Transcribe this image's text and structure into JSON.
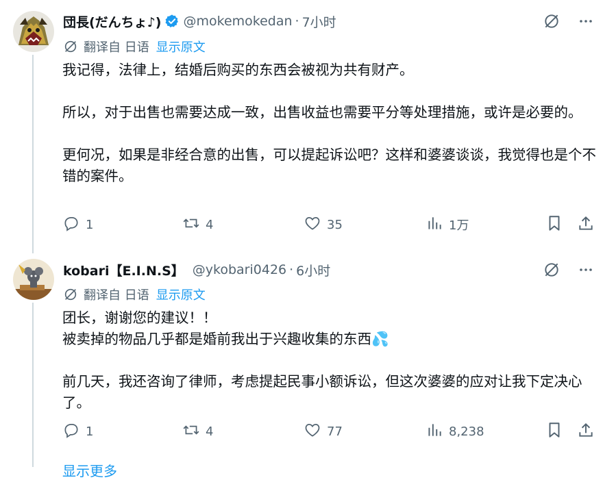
{
  "tweets": [
    {
      "display_name": "団長(だんちょ♪)",
      "verified": true,
      "handle": "@mokemokedan",
      "separator": "·",
      "time": "7小时",
      "translated_from": "翻译自 日语",
      "show_original": "显示原文",
      "text": "我记得，法律上，结婚后购买的东西会被视为共有财产。\n\n所以，对于出售也需要达成一致，出售收益也需要平分等处理措施，或许是必要的。\n\n更何况，如果是非经合意的出售，可以提起诉讼吧？这样和婆婆谈谈，我觉得也是个不错的案件。",
      "replies": "1",
      "reposts": "4",
      "likes": "35",
      "views": "1万"
    },
    {
      "display_name": "kobari【E.I.N.S】",
      "verified": false,
      "handle": "@ykobari0426",
      "separator": "·",
      "time": "6小时",
      "translated_from": "翻译自 日语",
      "show_original": "显示原文",
      "text": "团长，谢谢您的建议！！\n被卖掉的物品几乎都是婚前我出于兴趣收集的东西💦\n\n前几天，我还咨询了律师，考虑提起民事小额诉讼，但这次婆婆的应对让我下定决心了。",
      "replies": "1",
      "reposts": "4",
      "likes": "77",
      "views": "8,238"
    }
  ],
  "footer": {
    "more_link": "显示更多"
  },
  "colors": {
    "accent": "#1d9bf0",
    "secondary_text": "#536471",
    "thread_line": "#cfd9de"
  }
}
